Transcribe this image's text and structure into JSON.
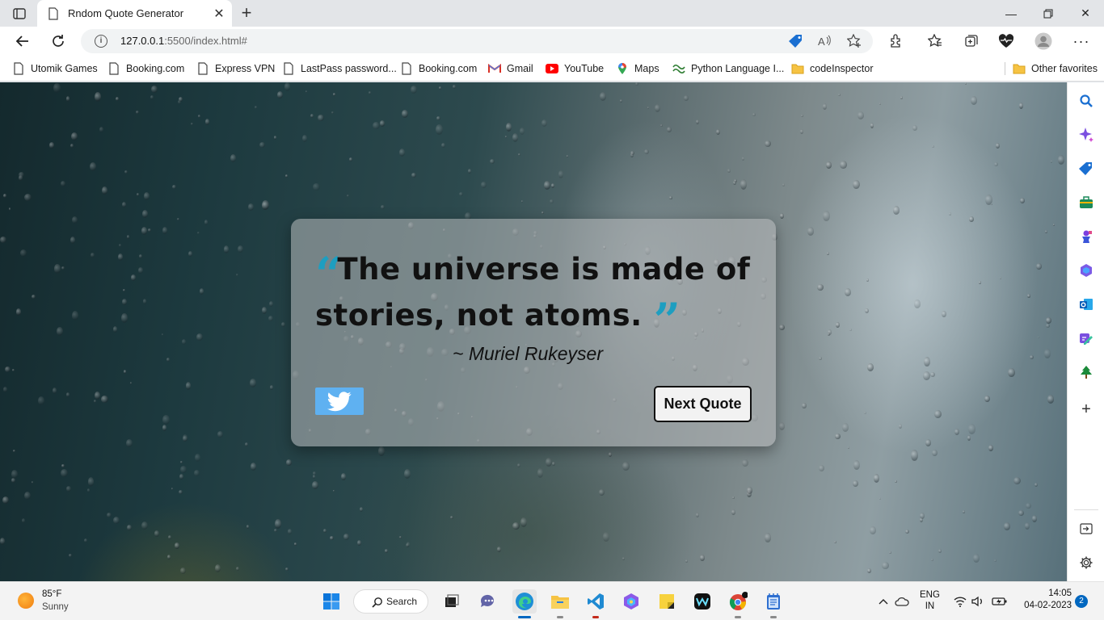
{
  "browser": {
    "tab_title": "Rndom Quote Generator",
    "url_host": "127.0.0.1",
    "url_rest": ":5500/index.html#"
  },
  "favorites": [
    {
      "label": "Utomik Games",
      "icon": "page-icon"
    },
    {
      "label": "Booking.com",
      "icon": "page-icon"
    },
    {
      "label": "Express VPN",
      "icon": "page-icon"
    },
    {
      "label": "LastPass password...",
      "icon": "page-icon"
    },
    {
      "label": "Booking.com",
      "icon": "page-icon"
    },
    {
      "label": "Gmail",
      "icon": "gmail-icon"
    },
    {
      "label": "YouTube",
      "icon": "youtube-icon"
    },
    {
      "label": "Maps",
      "icon": "maps-icon"
    },
    {
      "label": "Python Language I...",
      "icon": "python-icon"
    },
    {
      "label": "codeInspector",
      "icon": "folder-icon"
    }
  ],
  "other_favorites": "Other favorites",
  "page": {
    "quote_text": "The universe is made of stories, not atoms.",
    "author": "~ Muriel Rukeyser",
    "next_button": "Next Quote",
    "accent_color": "#1e9ec0",
    "tweet_button_color": "#5fb1f1"
  },
  "taskbar": {
    "weather_temp": "85°F",
    "weather_desc": "Sunny",
    "search_label": "Search",
    "lang_line1": "ENG",
    "lang_line2": "IN",
    "time": "14:05",
    "date": "04-02-2023",
    "notification_count": "2"
  }
}
